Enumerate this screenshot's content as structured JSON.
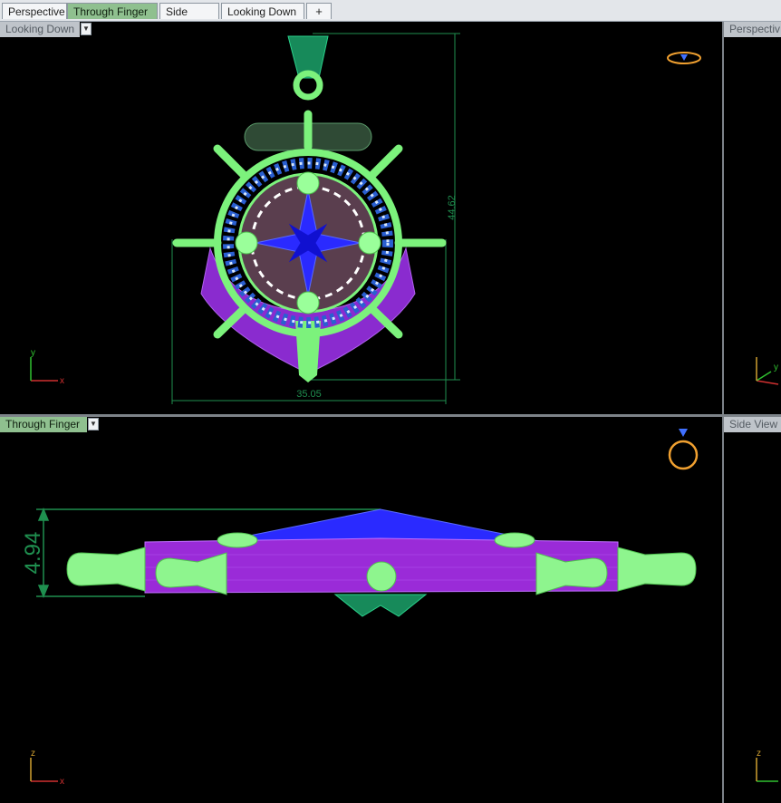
{
  "tabs": [
    {
      "label": "Perspective",
      "active": false
    },
    {
      "label": "Through Finger",
      "active": true
    },
    {
      "label": "Side View",
      "active": false
    },
    {
      "label": "Looking Down",
      "active": false
    }
  ],
  "add_tab_symbol": "+",
  "viewports": {
    "top_left": {
      "label": "Looking Down",
      "dim_height": "44.62",
      "dim_width": "35.05",
      "axis_x": "x",
      "axis_y": "y"
    },
    "top_right": {
      "label": "Perspectiv",
      "axis_y": "y"
    },
    "bottom_left": {
      "label": "Through Finger",
      "dim_thickness": "4.94",
      "axis_z": "z",
      "axis_x": "x"
    },
    "bottom_right": {
      "label": "Side View",
      "axis_z": "z"
    }
  },
  "colors": {
    "wire_green": "#7cf27c",
    "star_blue": "#2a2aff",
    "anchor_purple": "#9a2bd8",
    "dim_green": "#1f8f4f",
    "active_tab": "#8fc08f"
  },
  "icons": [
    "ring-orientation-icon",
    "dropdown-arrow-icon",
    "axis-indicator-icon",
    "plus-icon"
  ]
}
